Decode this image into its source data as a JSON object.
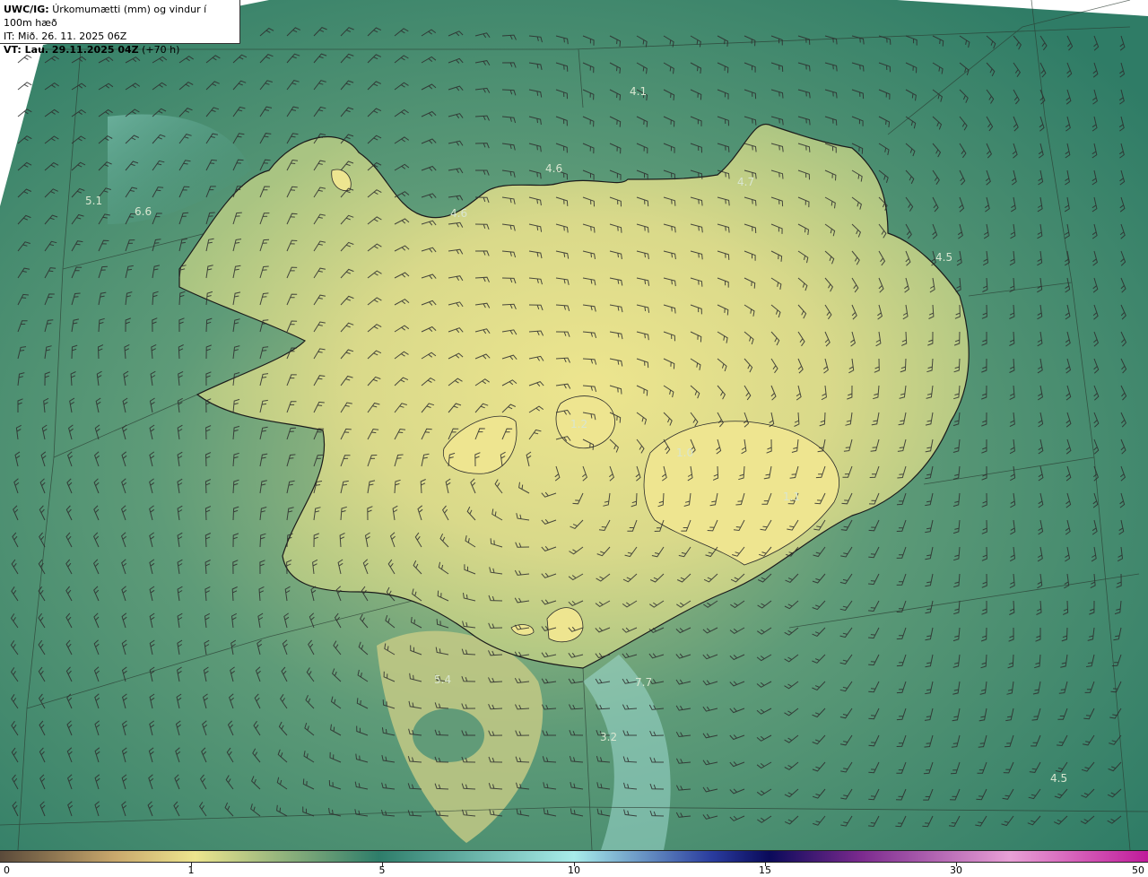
{
  "header": {
    "model": "UWC/IG:",
    "title": "Úrkomumætti (mm) og vindur í 100m hæð",
    "init_label": "IT: Mið. 26. 11. 2025 06Z",
    "valid_label": "VT: Lau. 29.11.2025 04Z",
    "lead": "(+70 h)"
  },
  "map_values": [
    {
      "id": "v1",
      "text": "4.1"
    },
    {
      "id": "v2",
      "text": "4.6"
    },
    {
      "id": "v3",
      "text": "4.6"
    },
    {
      "id": "v4",
      "text": "4.7"
    },
    {
      "id": "v5",
      "text": "5.1"
    },
    {
      "id": "v6",
      "text": "6.6"
    },
    {
      "id": "v7",
      "text": "4.5"
    },
    {
      "id": "v8",
      "text": "1.2"
    },
    {
      "id": "v9",
      "text": "1.0"
    },
    {
      "id": "v10",
      "text": "1.1"
    },
    {
      "id": "v11",
      "text": "5.4"
    },
    {
      "id": "v12",
      "text": "7.7"
    },
    {
      "id": "v13",
      "text": "3.2"
    },
    {
      "id": "v14",
      "text": "4.5"
    }
  ],
  "colorbar": {
    "labels": [
      "0",
      "1",
      "5",
      "10",
      "15",
      "30",
      "50"
    ],
    "colors": [
      "#5a4a3a",
      "#c9a86c",
      "#ede58e",
      "#2e7d6a",
      "#a8ecea",
      "#2a3c9e",
      "#0a0a5a",
      "#7b2a8e",
      "#e9a0d6",
      "#c01a9a"
    ]
  }
}
